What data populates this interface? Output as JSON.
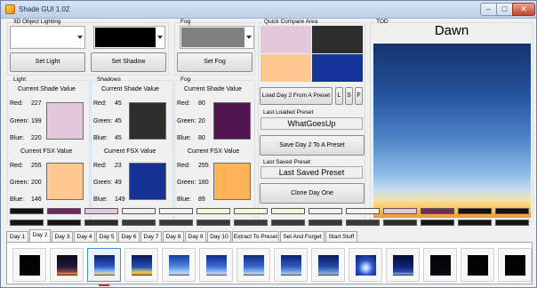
{
  "window": {
    "title": "Shade GUI 1.02",
    "minimize": "–",
    "maximize": "□",
    "close": "✕"
  },
  "groups": {
    "lighting": "3D Object Lighting",
    "fog": "Fog",
    "compare": "Quick Compare Area",
    "tod": "TOD",
    "light": "Light",
    "shadows": "Shadows",
    "fog2": "Fog"
  },
  "dropdowns": {
    "light": "#ffffff",
    "shadow": "#000000",
    "fog": "#808080"
  },
  "buttons": {
    "set_light": "Set Light",
    "set_shadow": "Set Shadow",
    "set_fog": "Set Fog",
    "load_day2": "Load Day 2 From A Preset",
    "l": "L",
    "s": "S",
    "f": "F",
    "save_day2": "Save Day 2 To A Preset",
    "clone_day1": "Clone Day One"
  },
  "compare": {
    "colors": [
      "#e3c7dc",
      "#2d2d2d",
      "#ffc892",
      "#17349a"
    ]
  },
  "presets": {
    "last_loaded_label": "Last Loaded Preset",
    "last_loaded_value": "WhatGoesUp",
    "last_saved_label": "Last Saved Preset",
    "last_saved_value": "Last Saved Preset"
  },
  "tod_value": "Dawn",
  "labels": {
    "current_shade": "Current Shade Value",
    "current_fsx": "Current FSX Value",
    "red": "Red:",
    "green": "Green:",
    "blue": "Blue:"
  },
  "panels": {
    "light": {
      "shade": {
        "r": "227",
        "g": "199",
        "b": "220",
        "color": "#e3c7dc"
      },
      "fsx": {
        "r": "255",
        "g": "200",
        "b": "146",
        "color": "#ffc892"
      }
    },
    "shadows": {
      "shade": {
        "r": "45",
        "g": "45",
        "b": "45",
        "color": "#2d2d2d"
      },
      "fsx": {
        "r": "23",
        "g": "49",
        "b": "149",
        "color": "#173195"
      }
    },
    "fog": {
      "shade": {
        "r": "80",
        "g": "20",
        "b": "80",
        "color": "#501450"
      },
      "fsx": {
        "r": "255",
        "g": "180",
        "b": "89",
        "color": "#ffb459"
      }
    }
  },
  "strips": {
    "top": [
      "#111111",
      "#6f2a63",
      "#e3c7dc",
      "#f0f0f0",
      "#f2f2f2",
      "#fbf7dd",
      "#fbf7dd",
      "#fbf7dd",
      "#f4f4f4",
      "#f4f4f4",
      "#e3c7dc",
      "#6f2a63",
      "#111111",
      "#111111"
    ],
    "bottom": [
      "#151515",
      "#151515",
      "#2d2d2d",
      "#3a3a3a",
      "#3a3a3a",
      "#3a3a3a",
      "#3a3a3a",
      "#3a3a3a",
      "#3a3a3a",
      "#3a3a3a",
      "#2d2d2d",
      "#151515",
      "#151515",
      "#151515"
    ]
  },
  "tabs": [
    "Day 1",
    "Day 2",
    "Day 3",
    "Day 4",
    "Day 5",
    "Day 6",
    "Day 7",
    "Day 8",
    "Day 9",
    "Day 10",
    "Extract To Preset",
    "Set And Forget",
    "Start Stuff"
  ],
  "active_tab": "Day 2",
  "thumbnails": [
    {
      "name": "midnight",
      "gradient": "linear-gradient(#000, #050505)"
    },
    {
      "name": "pre-dawn",
      "gradient": "linear-gradient(#0b0b1a 0%, #20183a 55%, #7a3a48 80%, #f08a40 92%, #15100c 100%)"
    },
    {
      "name": "dawn",
      "gradient": "linear-gradient(#0c1d66 0%, #2e58c6 55%, #8fc2f2 82%, #ffd06a 92%, #2a2a3a 100%)",
      "selected": true
    },
    {
      "name": "sunrise",
      "gradient": "linear-gradient(#0b1a55 0%, #244fb8 58%, #c8c86a 82%, #ffb040 92%, #201810 100%)"
    },
    {
      "name": "morning",
      "gradient": "linear-gradient(#1a3a9a 0%, #4f86de 55%, #9cc6f4 80%, #c9d8ea 92%, #2a3040 100%)"
    },
    {
      "name": "midday",
      "gradient": "linear-gradient(#0f2b8a 0%, #3a6cd6 55%, #86b6ee 80%, #cfd9e8 92%, #283040 100%)"
    },
    {
      "name": "afternoon",
      "gradient": "linear-gradient(#11297e 0%, #3767cf 55%, #7fb0ea 80%, #c9d4e4 92%, #262c3a 100%)"
    },
    {
      "name": "late-afternoon",
      "gradient": "linear-gradient(#0d216e 0%, #2f5ac0 55%, #6f9fe0 80%, #b8c7dc 92%, #222838 100%)"
    },
    {
      "name": "evening",
      "gradient": "linear-gradient(#0a1a5a 0%, #2549a8 55%, #5d8ad0 80%, #a6b8d0 92%, #1e2334 100%)"
    },
    {
      "name": "sunset",
      "gradient": "radial-gradient(circle at 50% 62%, #ffffff 0%, #9fc4ff 18%, #2b52c8 45%, #0b1a5a 100%)"
    },
    {
      "name": "dusk",
      "gradient": "linear-gradient(#060d33 0%, #12257a 60%, #2b4ab0 82%, #8fa8d8 92%, #14182a 100%)"
    },
    {
      "name": "night",
      "gradient": "linear-gradient(#020208, #0a0a12)"
    },
    {
      "name": "late-night",
      "gradient": "linear-gradient(#000, #050505)"
    },
    {
      "name": "deep-night",
      "gradient": "linear-gradient(#000, #050505)"
    }
  ]
}
